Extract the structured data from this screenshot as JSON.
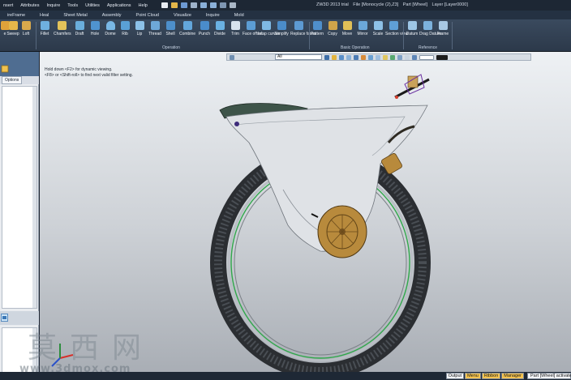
{
  "menu": [
    "nsert",
    "Attributes",
    "Inquire",
    "Tools",
    "Utilities",
    "Applications",
    "Help"
  ],
  "title": {
    "app": "ZW3D 2013 trial",
    "file": "File [Monocycle (2),Z3]",
    "part": "Part [Wheel]",
    "layer": "Layer [Layer0000]"
  },
  "tabs": [
    "ireFrame",
    "Heal",
    "Sheet Metal",
    "Assembly",
    "Point Cloud",
    "Visualize",
    "Inquire",
    "Mold"
  ],
  "ribbon": {
    "tools": [
      "e",
      "Sweep",
      "Loft",
      "Fillet",
      "Chamfers",
      "Draft",
      "Hole",
      "Dome",
      "Rib",
      "Lip",
      "Thread",
      "Shell",
      "Combine",
      "Punch",
      "Divide",
      "Trim",
      "Face offset",
      "Inlap curves",
      "Simplify",
      "Replace faces",
      "Pattern",
      "Copy",
      "Move",
      "Mirror",
      "Scale",
      "Section view",
      "Datum",
      "Drag Datum",
      "Frame"
    ],
    "groups": {
      "operation": "Operation",
      "basic_operation": "Basic Operation",
      "reference": "Reference"
    }
  },
  "left_panel": {
    "tab_options": "Options"
  },
  "viewport": {
    "filter_value": "All",
    "hint_line1": "Hold down <F2> for dynamic viewing.",
    "hint_line2": "<F8> or <Shift-roll> to find next valid filter setting."
  },
  "status": {
    "output": "Output",
    "menu": "Menu",
    "ribbon": "Ribbon",
    "manager": "Manager",
    "message": "Part [Wheel] activated."
  },
  "watermark": {
    "chinese": "莫西网",
    "url": "www.3dmox.com"
  },
  "colors": {
    "ribbon_bg": "#34455a",
    "status_active": "#f5c451",
    "wheel_green": "#2fa84a",
    "hub_gold": "#b88a3c"
  }
}
